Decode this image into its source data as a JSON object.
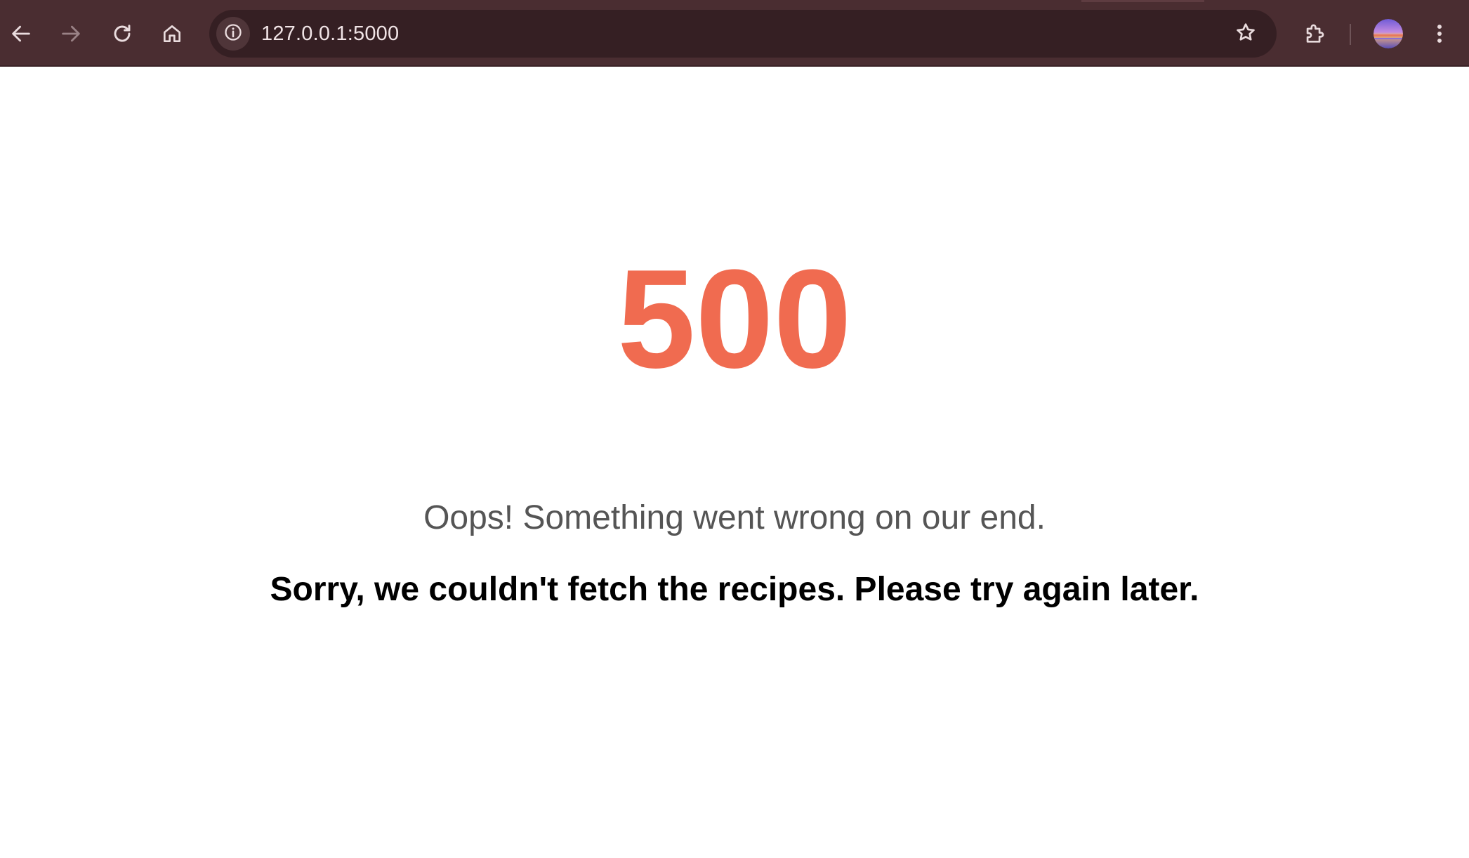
{
  "browser": {
    "url": "127.0.0.1:5000",
    "icons": {
      "back": "arrow-left-icon",
      "forward": "arrow-right-icon",
      "reload": "reload-icon",
      "home": "home-icon",
      "site_info": "info-icon",
      "bookmark": "star-icon",
      "extensions": "puzzle-icon",
      "profile": "avatar",
      "menu": "kebab-menu-icon"
    },
    "colors": {
      "toolbar": "#4a2d31",
      "omnibox": "#351f23"
    }
  },
  "page": {
    "error_code": "500",
    "message": "Oops! Something went wrong on our end.",
    "detail": "Sorry, we couldn't fetch the recipes. Please try again later.",
    "colors": {
      "error_code": "#f06b50",
      "message": "#555555",
      "detail": "#000000"
    }
  }
}
